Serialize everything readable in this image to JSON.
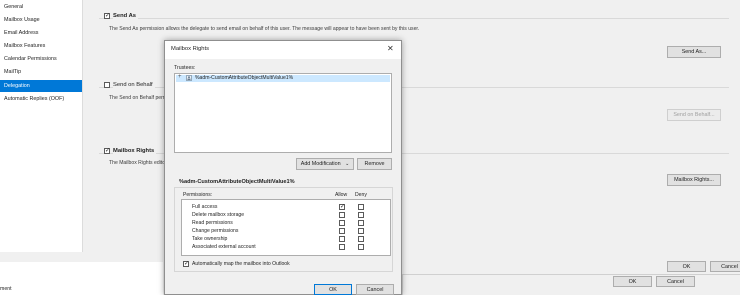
{
  "sidebar": {
    "items": [
      {
        "label": "General",
        "selected": false
      },
      {
        "label": "Mailbox Usage",
        "selected": false
      },
      {
        "label": "Email Address",
        "selected": false
      },
      {
        "label": "Mailbox Features",
        "selected": false
      },
      {
        "label": "Calendar Permissions",
        "selected": false
      },
      {
        "label": "MailTip",
        "selected": false
      },
      {
        "label": "Delegation",
        "selected": true
      },
      {
        "label": "Automatic Replies (OOF)",
        "selected": false
      }
    ]
  },
  "sections": {
    "send_as": {
      "title": "Send As",
      "checked": true,
      "description": "The Send As permission allows the delegate to send email on behalf of this user. The message will appear to have been sent by this user.",
      "button": "Send As..."
    },
    "send_on_behalf": {
      "title": "Send on Behalf",
      "checked": false,
      "description": "The Send on Behalf permission",
      "button": "Send on Behalf..."
    },
    "mailbox_rights": {
      "title": "Mailbox Rights",
      "checked": true,
      "description": "The Mailbox Rights editor",
      "button": "Mailbox Rights..."
    }
  },
  "footer": {
    "ok": "OK",
    "cancel": "Cancel",
    "behind_ok": "OK",
    "behind_cancel": "Cancel",
    "partial_text": "ment"
  },
  "dialog": {
    "title": "Mailbox Rights",
    "trustees_label": "Trustees:",
    "trustee": "%adm-CustomAttributeObjectMultiValue1%",
    "add_modification": "Add Modification",
    "remove": "Remove",
    "selected_trustee": "%adm-CustomAttributeObjectMultiValue1%",
    "permissions_header": "Permissions:",
    "allow_header": "Allow",
    "deny_header": "Deny",
    "permissions": [
      {
        "label": "Full access",
        "allow": true,
        "deny": false
      },
      {
        "label": "Delete mailbox storage",
        "allow": false,
        "deny": false
      },
      {
        "label": "Read permissions",
        "allow": false,
        "deny": false
      },
      {
        "label": "Change permissions",
        "allow": false,
        "deny": false
      },
      {
        "label": "Take ownership",
        "allow": false,
        "deny": false
      },
      {
        "label": "Associated external account",
        "allow": false,
        "deny": false
      }
    ],
    "automap_label": "Automatically map the mailbox into Outlook",
    "automap_checked": true,
    "ok": "OK",
    "cancel": "Cancel"
  },
  "colors": {
    "accent": "#0078d7",
    "panel": "#f0f0f0",
    "selected_row": "#cce8ff"
  },
  "icons": {
    "expand": "plus-icon",
    "trustee": "user-group-icon",
    "close": "close-icon",
    "dropdown": "chevron-down-icon"
  }
}
